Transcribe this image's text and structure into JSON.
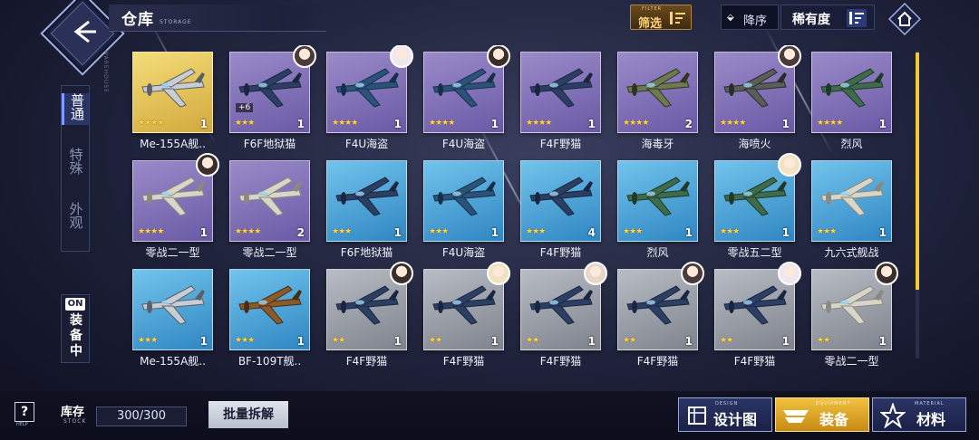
{
  "header": {
    "title": "仓库",
    "title_en": "STORAGE",
    "side_label": "WAREHOUSE",
    "filter_label": "筛选",
    "filter_en": "FILTER",
    "sort_order_label": "降序",
    "sort_key_label": "稀有度"
  },
  "tabs": [
    {
      "label": "普通",
      "active": true
    },
    {
      "label": "特殊",
      "active": false
    },
    {
      "label": "外观",
      "active": false
    }
  ],
  "equip_toggle": {
    "badge": "ON",
    "label": "装备中"
  },
  "items": [
    {
      "name": "Me-155A舰..",
      "rarity": "gold",
      "stars": "★★★★",
      "count": "1",
      "avatar": false,
      "plus": "",
      "plane": "gray-fighter"
    },
    {
      "name": "F6F地狱猫",
      "rarity": "purple",
      "stars": "★★★",
      "count": "1",
      "avatar": true,
      "plus": "+6",
      "plane": "navy-fighter"
    },
    {
      "name": "F4U海盗",
      "rarity": "purple",
      "stars": "★★★★",
      "count": "1",
      "avatar": true,
      "plus": "",
      "plane": "corsair"
    },
    {
      "name": "F4U海盗",
      "rarity": "purple",
      "stars": "★★★★",
      "count": "1",
      "avatar": true,
      "plus": "",
      "plane": "corsair"
    },
    {
      "name": "F4F野猫",
      "rarity": "purple",
      "stars": "★★★★",
      "count": "1",
      "avatar": false,
      "plus": "",
      "plane": "navy-fighter"
    },
    {
      "name": "海毒牙",
      "rarity": "purple",
      "stars": "★★★★",
      "count": "2",
      "avatar": false,
      "plus": "",
      "plane": "striped-fighter"
    },
    {
      "name": "海喷火",
      "rarity": "purple",
      "stars": "★★★★",
      "count": "1",
      "avatar": true,
      "plus": "",
      "plane": "dark-fighter"
    },
    {
      "name": "烈风",
      "rarity": "purple",
      "stars": "★★★★",
      "count": "1",
      "avatar": false,
      "plus": "",
      "plane": "green-fighter"
    },
    {
      "name": "零战二一型",
      "rarity": "purple",
      "stars": "★★★★",
      "count": "1",
      "avatar": true,
      "plus": "",
      "plane": "zero"
    },
    {
      "name": "零战二一型",
      "rarity": "purple",
      "stars": "★★★★",
      "count": "2",
      "avatar": false,
      "plus": "",
      "plane": "zero"
    },
    {
      "name": "F6F地狱猫",
      "rarity": "blue",
      "stars": "★★★",
      "count": "1",
      "avatar": false,
      "plus": "",
      "plane": "navy-fighter"
    },
    {
      "name": "F4U海盗",
      "rarity": "blue",
      "stars": "★★★",
      "count": "1",
      "avatar": false,
      "plus": "",
      "plane": "corsair"
    },
    {
      "name": "F4F野猫",
      "rarity": "blue",
      "stars": "★★★",
      "count": "4",
      "avatar": false,
      "plus": "",
      "plane": "navy-fighter"
    },
    {
      "name": "烈风",
      "rarity": "blue",
      "stars": "★★★",
      "count": "1",
      "avatar": false,
      "plus": "",
      "plane": "green-fighter"
    },
    {
      "name": "零战五二型",
      "rarity": "blue",
      "stars": "★★★",
      "count": "1",
      "avatar": true,
      "plus": "",
      "plane": "green-fighter"
    },
    {
      "name": "九六式舰战",
      "rarity": "blue",
      "stars": "★★★",
      "count": "1",
      "avatar": false,
      "plus": "",
      "plane": "zero"
    },
    {
      "name": "Me-155A舰..",
      "rarity": "blue",
      "stars": "★★★",
      "count": "1",
      "avatar": false,
      "plus": "",
      "plane": "gray-fighter"
    },
    {
      "name": "BF-109T舰..",
      "rarity": "blue",
      "stars": "★★★",
      "count": "1",
      "avatar": false,
      "plus": "",
      "plane": "brown-fighter"
    },
    {
      "name": "F4F野猫",
      "rarity": "gray",
      "stars": "★★",
      "count": "1",
      "avatar": true,
      "plus": "",
      "plane": "navy-fighter"
    },
    {
      "name": "F4F野猫",
      "rarity": "gray",
      "stars": "★★",
      "count": "1",
      "avatar": true,
      "plus": "",
      "plane": "navy-fighter"
    },
    {
      "name": "F4F野猫",
      "rarity": "gray",
      "stars": "★★",
      "count": "1",
      "avatar": true,
      "plus": "",
      "plane": "navy-fighter"
    },
    {
      "name": "F4F野猫",
      "rarity": "gray",
      "stars": "★★",
      "count": "1",
      "avatar": true,
      "plus": "",
      "plane": "navy-fighter"
    },
    {
      "name": "F4F野猫",
      "rarity": "gray",
      "stars": "★★",
      "count": "1",
      "avatar": true,
      "plus": "",
      "plane": "navy-fighter"
    },
    {
      "name": "零战二一型",
      "rarity": "gray",
      "stars": "★★",
      "count": "1",
      "avatar": true,
      "plus": "",
      "plane": "zero"
    }
  ],
  "footer": {
    "help_text": "HELP",
    "stock_label": "库存",
    "stock_en": "STOCK",
    "stock_value": "300/300",
    "bulk_label": "批量拆解",
    "design_label": "设计图",
    "design_en": "DESIGN",
    "equipment_label": "装备",
    "equipment_en": "EQUIPMENT",
    "material_label": "材料",
    "material_en": "MATERIAL"
  },
  "colors": {
    "gold": "#d2a93c",
    "purple": "#6a5aa6",
    "blue": "#2f86c2",
    "gray": "#7e838d",
    "accent": "#f2c936"
  }
}
